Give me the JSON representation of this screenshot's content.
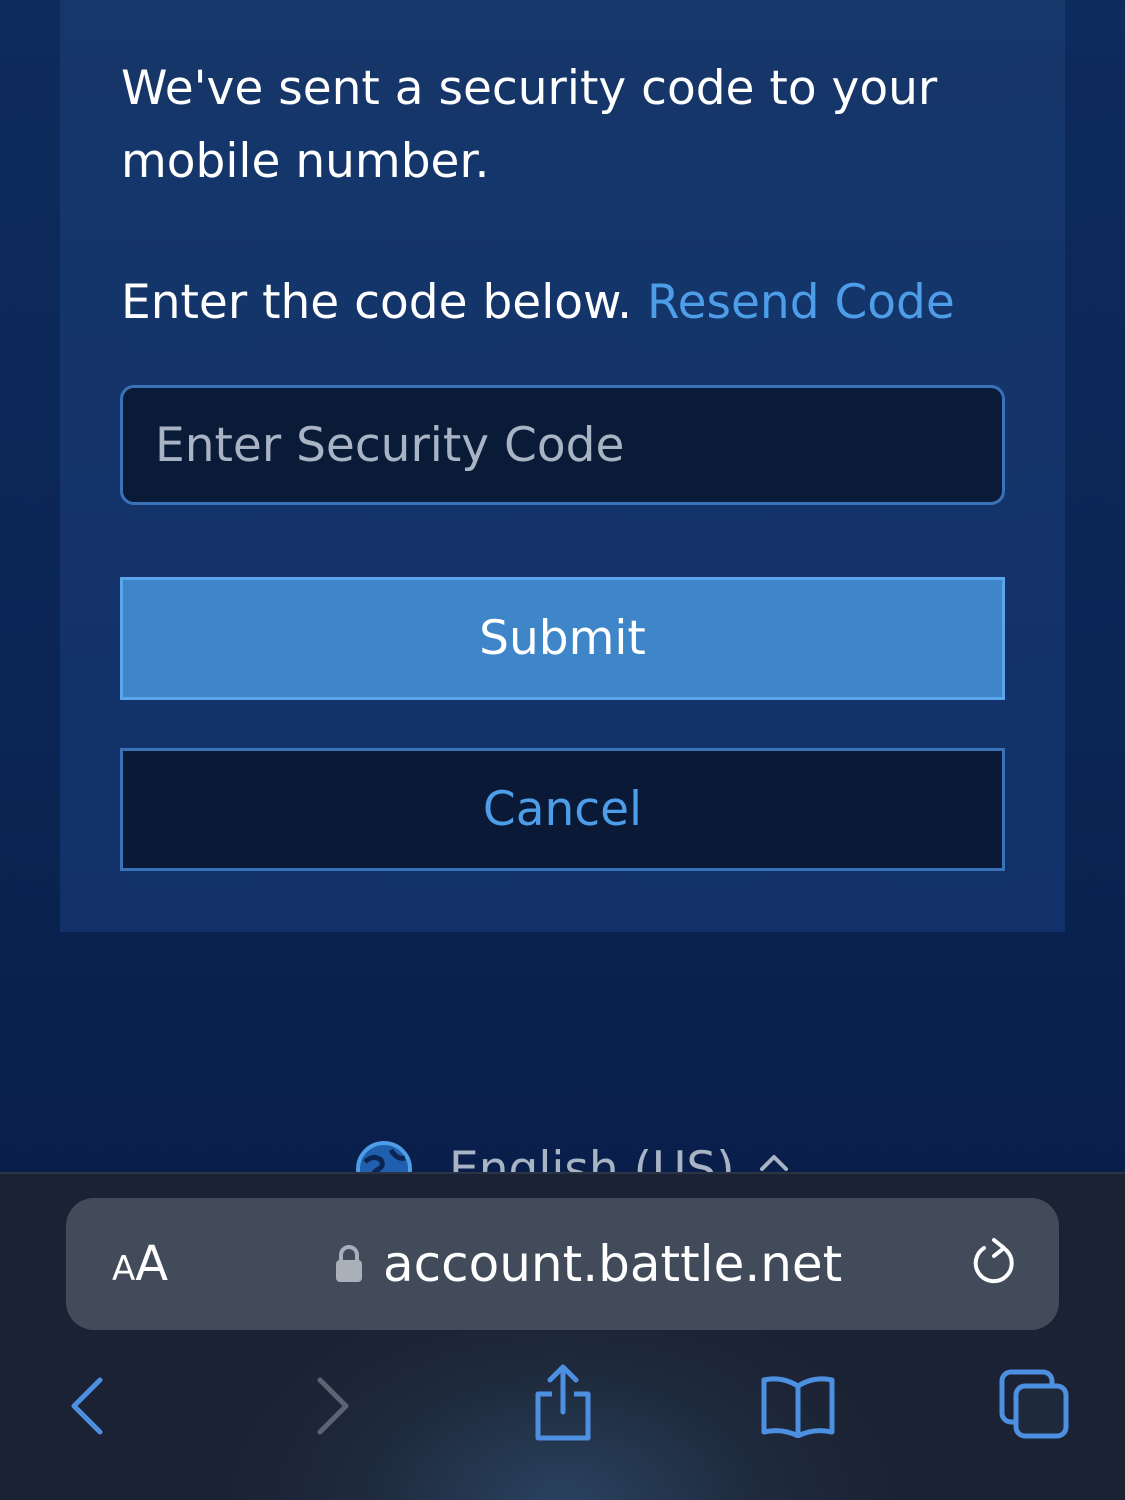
{
  "security": {
    "intro": "We've sent a security code to your mobile number.",
    "prompt": "Enter the code below.",
    "resend_label": "Resend Code",
    "input_placeholder": "Enter Security Code",
    "submit_label": "Submit",
    "cancel_label": "Cancel"
  },
  "language": {
    "label": "English (US)"
  },
  "browser": {
    "text_size_small": "A",
    "text_size_large": "A",
    "url": "account.battle.net"
  },
  "icons": {
    "language": "globe-icon",
    "language_toggle": "chevron-up-icon",
    "secure": "lock-icon",
    "reload": "reload-icon",
    "back": "chevron-left-icon",
    "forward": "chevron-right-icon",
    "share": "share-icon",
    "bookmarks": "book-icon",
    "tabs": "tabs-icon"
  },
  "colors": {
    "background": "#0b2655",
    "card": "#14356a",
    "link": "#4d9de8",
    "submit": "#3f86c8",
    "input": "#0a1b38",
    "toolbar": "#1e2a3c",
    "url_bar": "#424b5a"
  }
}
